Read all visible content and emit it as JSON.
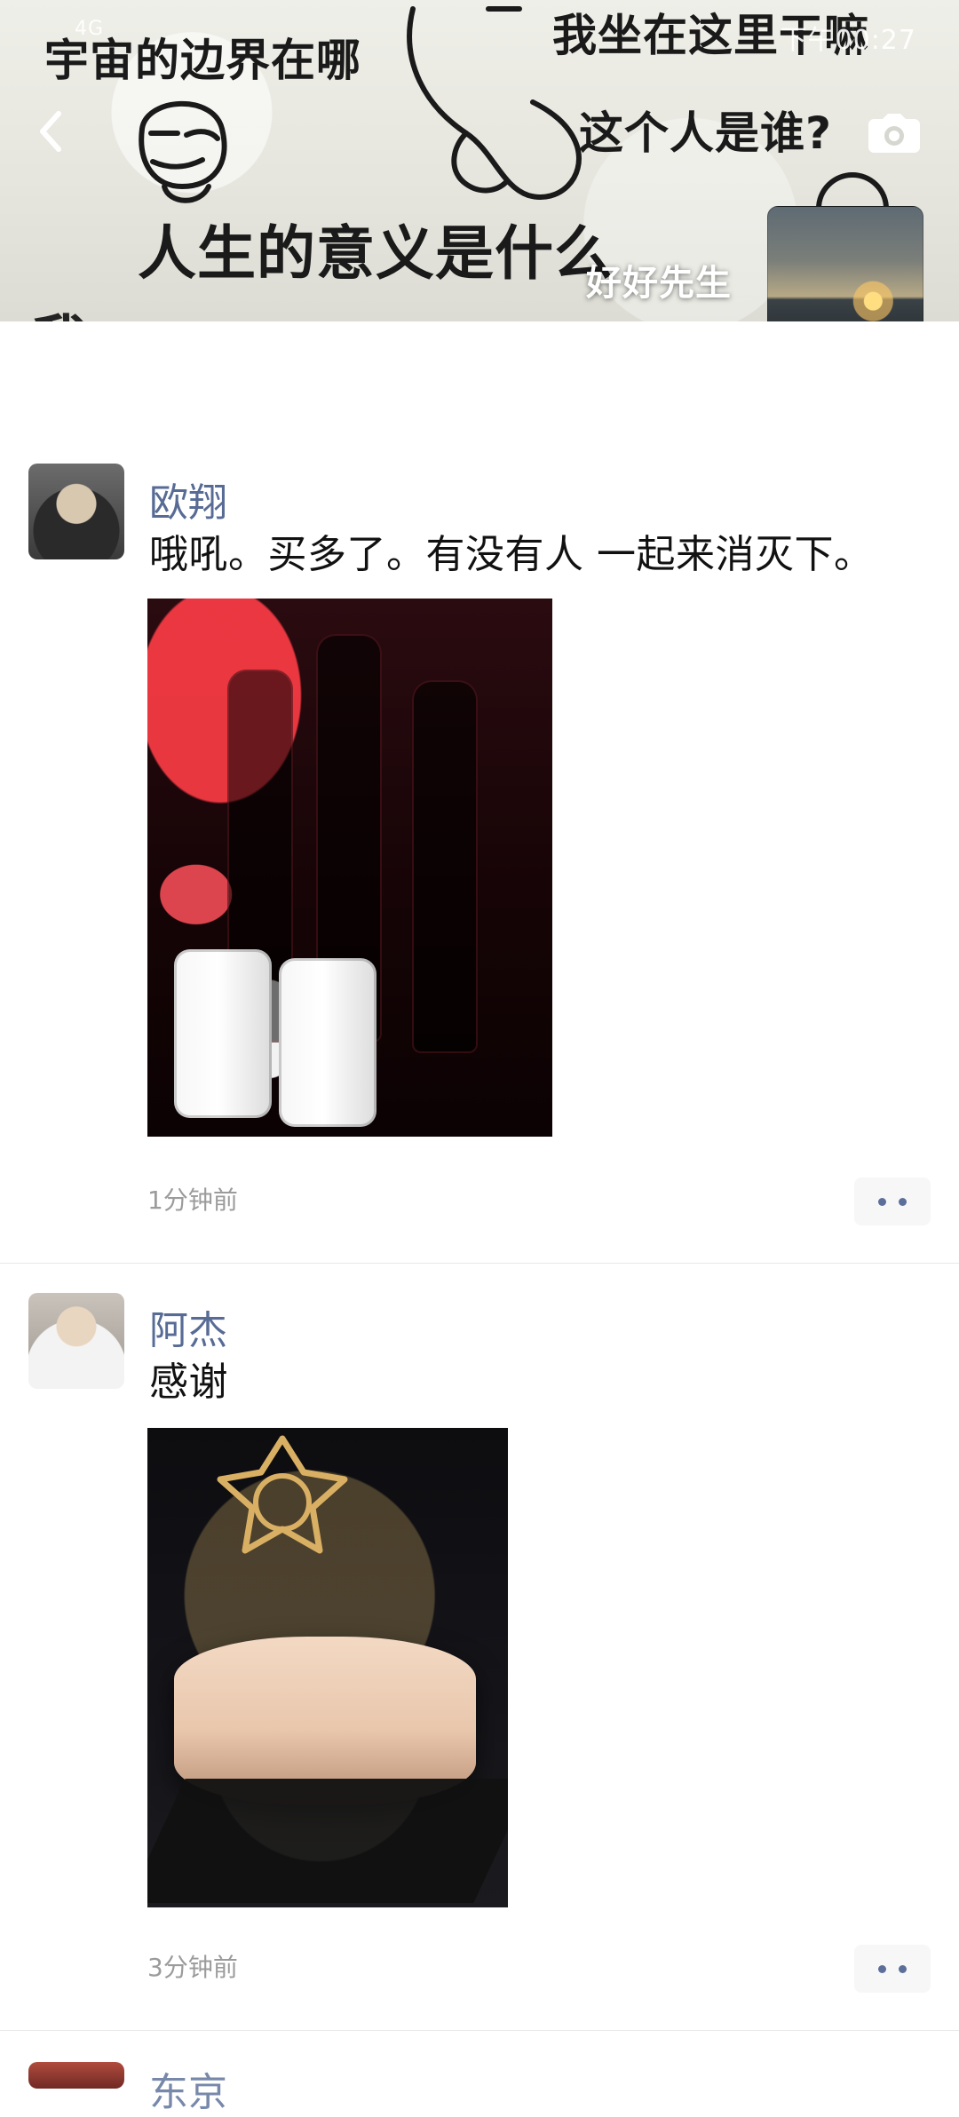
{
  "status_bar": {
    "network": "4G",
    "time": "下午00:27"
  },
  "cover": {
    "meme_texts": [
      "宇宙的边界在哪",
      "我坐在这里干嘛",
      "这个人是谁?",
      "人生的意义是什么",
      "我"
    ],
    "profile_name": "好好先生",
    "icons": {
      "back": "back-chevron-icon",
      "camera": "camera-icon"
    }
  },
  "posts": [
    {
      "author": "欧翔",
      "text": "哦吼。买多了。有没有人 一起来消灭下。",
      "time": "1分钟前",
      "more_label": "••"
    },
    {
      "author": "阿杰",
      "text": "感谢",
      "time": "3分钟前",
      "more_label": "••"
    }
  ],
  "peek": {
    "author_partial": "东京"
  },
  "colors": {
    "author_link": "#576b95",
    "time_gray": "#9b9b9b",
    "divider": "#e8e8e8",
    "more_bg": "#f7f7f7"
  }
}
